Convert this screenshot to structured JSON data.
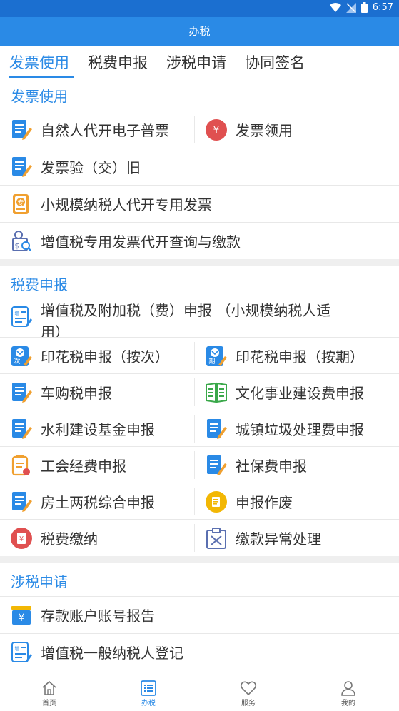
{
  "status": {
    "time": "6:57"
  },
  "title": "办税",
  "tabs": [
    {
      "label": "发票使用"
    },
    {
      "label": "税费申报"
    },
    {
      "label": "涉税申请"
    },
    {
      "label": "协同签名"
    }
  ],
  "sections": {
    "invoice": {
      "title": "发票使用",
      "items": [
        {
          "label": "自然人代开电子普票",
          "icon": "document-edit-icon"
        },
        {
          "label": "发票领用",
          "icon": "yuan-coin-icon"
        },
        {
          "label": "发票验（交）旧",
          "icon": "document-edit-icon"
        },
        {
          "label": "小规模纳税人代开专用发票",
          "icon": "special-invoice-icon"
        },
        {
          "label": "增值税专用发票代开查询与缴款",
          "icon": "query-payment-icon"
        }
      ]
    },
    "declare": {
      "title": "税费申报",
      "items": [
        {
          "label": "增值税及附加税（费）申报 （小规模纳税人适",
          "label2": "用）",
          "icon": "vat-declare-icon"
        },
        {
          "label": "印花税申报（按次）",
          "icon": "stamp-per-time-icon",
          "badge": "次"
        },
        {
          "label": "印花税申报（按期）",
          "icon": "stamp-per-period-icon",
          "badge": "期"
        },
        {
          "label": "车购税申报",
          "icon": "document-edit-icon"
        },
        {
          "label": "文化事业建设费申报",
          "icon": "green-book-icon"
        },
        {
          "label": "水利建设基金申报",
          "icon": "document-edit-icon"
        },
        {
          "label": "城镇垃圾处理费申报",
          "icon": "document-edit-icon"
        },
        {
          "label": "工会经费申报",
          "icon": "orange-document-icon"
        },
        {
          "label": "社保费申报",
          "icon": "document-edit-icon"
        },
        {
          "label": "房土两税综合申报",
          "icon": "document-edit-icon"
        },
        {
          "label": "申报作废",
          "icon": "void-declare-icon"
        },
        {
          "label": "税费缴纳",
          "icon": "yuan-coin-icon"
        },
        {
          "label": "缴款异常处理",
          "icon": "payment-exception-icon"
        }
      ]
    },
    "apply": {
      "title": "涉税申请",
      "items": [
        {
          "label": "存款账户账号报告",
          "icon": "bank-account-icon"
        },
        {
          "label": "增值税一般纳税人登记",
          "icon": "vat-register-icon"
        }
      ]
    }
  },
  "bottom_nav": [
    {
      "label": "首页",
      "icon": "home-icon"
    },
    {
      "label": "办税",
      "icon": "list-icon"
    },
    {
      "label": "服务",
      "icon": "heart-icon"
    },
    {
      "label": "我的",
      "icon": "user-icon"
    }
  ],
  "colors": {
    "primary": "#2a8ae6",
    "statusbar": "#1b6fd0",
    "accent_orange": "#f0a030",
    "accent_red": "#e05050",
    "accent_green": "#3aa84a"
  }
}
